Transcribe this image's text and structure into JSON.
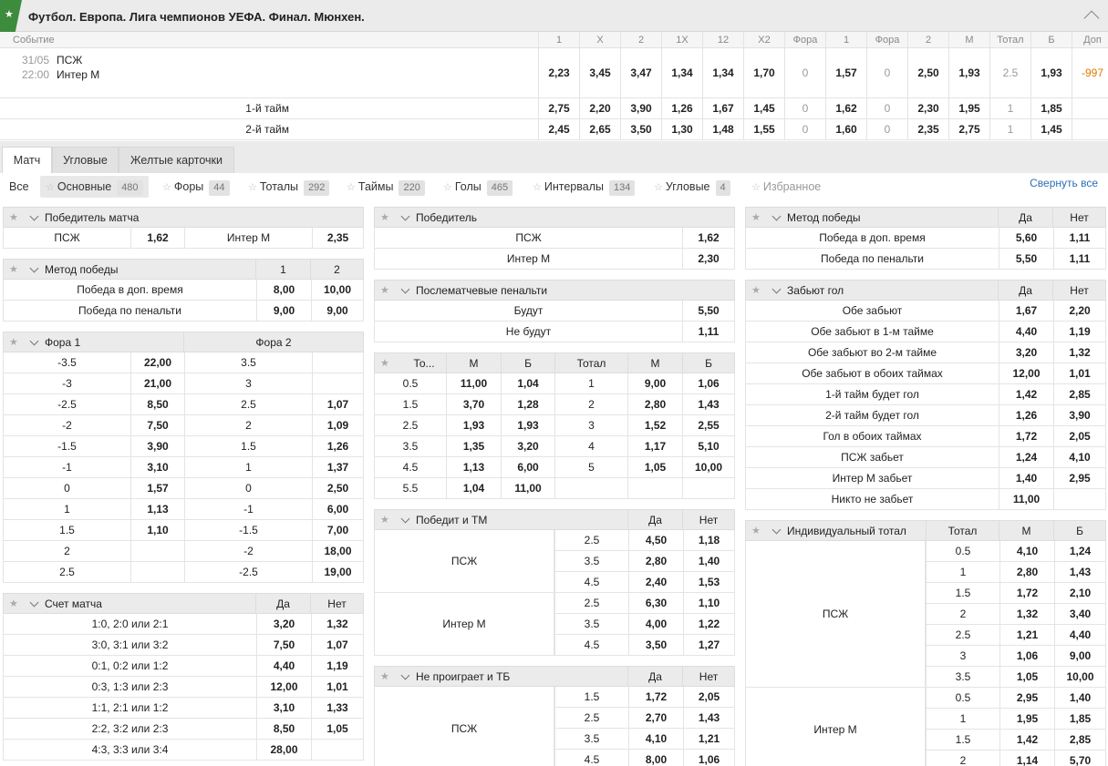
{
  "header": {
    "title": "Футбол. Европа. Лига чемпионов УЕФА. Финал. Мюнхен."
  },
  "market_cols": [
    "Событие",
    "1",
    "X",
    "2",
    "1X",
    "12",
    "X2",
    "Фора",
    "1",
    "Фора",
    "2",
    "М",
    "Тотал",
    "Б",
    "Доп"
  ],
  "event": {
    "date": "31/05",
    "time": "22:00",
    "team1": "ПСЖ",
    "team2": "Интер М",
    "odds": [
      "2,23",
      "3,45",
      "3,47",
      "1,34",
      "1,34",
      "1,70",
      "0",
      "1,57",
      "0",
      "2,50",
      "1,93",
      "2.5",
      "1,93",
      "-997"
    ]
  },
  "halves": [
    {
      "label": "1-й тайм",
      "odds": [
        "2,75",
        "2,20",
        "3,90",
        "1,26",
        "1,67",
        "1,45",
        "0",
        "1,62",
        "0",
        "2,30",
        "1,95",
        "1",
        "1,85"
      ]
    },
    {
      "label": "2-й тайм",
      "odds": [
        "2,45",
        "2,65",
        "3,50",
        "1,30",
        "1,48",
        "1,55",
        "0",
        "1,60",
        "0",
        "2,35",
        "2,75",
        "1",
        "1,45"
      ]
    }
  ],
  "tabs": [
    "Матч",
    "Угловые",
    "Желтые карточки"
  ],
  "filters": {
    "all": "Все",
    "items": [
      {
        "label": "Основные",
        "count": "480"
      },
      {
        "label": "Форы",
        "count": "44"
      },
      {
        "label": "Тоталы",
        "count": "292"
      },
      {
        "label": "Таймы",
        "count": "220"
      },
      {
        "label": "Голы",
        "count": "465"
      },
      {
        "label": "Интервалы",
        "count": "134"
      },
      {
        "label": "Угловые",
        "count": "4"
      },
      {
        "label": "Избранное",
        "count": ""
      }
    ],
    "collapse": "Свернуть все"
  },
  "tables": {
    "winner_match": {
      "title": "Победитель матча",
      "rows": [
        [
          "ПСЖ",
          "1,62",
          "Интер М",
          "2,35"
        ]
      ]
    },
    "win_method_1": {
      "title": "Метод победы",
      "h": [
        "1",
        "2"
      ],
      "rows": [
        [
          "Победа в доп. время",
          "8,00",
          "10,00"
        ],
        [
          "Победа по пенальти",
          "9,00",
          "9,00"
        ]
      ]
    },
    "handicap": {
      "title": "Фора 1",
      "title2": "Фора 2",
      "rows": [
        [
          "-3.5",
          "22,00",
          "3.5",
          ""
        ],
        [
          "-3",
          "21,00",
          "3",
          ""
        ],
        [
          "-2.5",
          "8,50",
          "2.5",
          "1,07"
        ],
        [
          "-2",
          "7,50",
          "2",
          "1,09"
        ],
        [
          "-1.5",
          "3,90",
          "1.5",
          "1,26"
        ],
        [
          "-1",
          "3,10",
          "1",
          "1,37"
        ],
        [
          "0",
          "1,57",
          "0",
          "2,50"
        ],
        [
          "1",
          "1,13",
          "-1",
          "6,00"
        ],
        [
          "1.5",
          "1,10",
          "-1.5",
          "7,00"
        ],
        [
          "2",
          "",
          "-2",
          "18,00"
        ],
        [
          "2.5",
          "",
          "-2.5",
          "19,00"
        ]
      ]
    },
    "score": {
      "title": "Счет матча",
      "h": [
        "Да",
        "Нет"
      ],
      "rows": [
        [
          "1:0, 2:0 или 2:1",
          "3,20",
          "1,32"
        ],
        [
          "3:0, 3:1 или 3:2",
          "7,50",
          "1,07"
        ],
        [
          "0:1, 0:2 или 1:2",
          "4,40",
          "1,19"
        ],
        [
          "0:3, 1:3 или 2:3",
          "12,00",
          "1,01"
        ],
        [
          "1:1, 2:1 или 1:2",
          "3,10",
          "1,33"
        ],
        [
          "2:2, 3:2 или 2:3",
          "8,50",
          "1,05"
        ],
        [
          "4:3, 3:3 или 3:4",
          "28,00",
          ""
        ]
      ]
    },
    "winner": {
      "title": "Победитель",
      "rows": [
        [
          "ПСЖ",
          "1,62"
        ],
        [
          "Интер М",
          "2,30"
        ]
      ]
    },
    "penalties": {
      "title": "Послематчевые пенальти",
      "rows": [
        [
          "Будут",
          "5,50"
        ],
        [
          "Не будут",
          "1,11"
        ]
      ]
    },
    "totals": {
      "h": [
        "То...",
        "М",
        "Б",
        "Тотал",
        "М",
        "Б"
      ],
      "rows": [
        [
          "0.5",
          "11,00",
          "1,04",
          "1",
          "9,00",
          "1,06"
        ],
        [
          "1.5",
          "3,70",
          "1,28",
          "2",
          "2,80",
          "1,43"
        ],
        [
          "2.5",
          "1,93",
          "1,93",
          "3",
          "1,52",
          "2,55"
        ],
        [
          "3.5",
          "1,35",
          "3,20",
          "4",
          "1,17",
          "5,10"
        ],
        [
          "4.5",
          "1,13",
          "6,00",
          "5",
          "1,05",
          "10,00"
        ],
        [
          "5.5",
          "1,04",
          "11,00",
          "",
          "",
          " "
        ]
      ]
    },
    "win_tm": {
      "title": "Победит и ТМ",
      "h": [
        "Да",
        "Нет"
      ],
      "groups": [
        {
          "team": "ПСЖ",
          "rows": [
            [
              "2.5",
              "4,50",
              "1,18"
            ],
            [
              "3.5",
              "2,80",
              "1,40"
            ],
            [
              "4.5",
              "2,40",
              "1,53"
            ]
          ]
        },
        {
          "team": "Интер М",
          "rows": [
            [
              "2.5",
              "6,30",
              "1,10"
            ],
            [
              "3.5",
              "4,00",
              "1,22"
            ],
            [
              "4.5",
              "3,50",
              "1,27"
            ]
          ]
        }
      ]
    },
    "nolose_tb": {
      "title": "Не проиграет и ТБ",
      "h": [
        "Да",
        "Нет"
      ],
      "groups": [
        {
          "team": "ПСЖ",
          "rows": [
            [
              "1.5",
              "1,72",
              "2,05"
            ],
            [
              "2.5",
              "2,70",
              "1,43"
            ],
            [
              "3.5",
              "4,10",
              "1,21"
            ],
            [
              "4.5",
              "8,00",
              "1,06"
            ]
          ]
        }
      ]
    },
    "win_method_2": {
      "title": "Метод победы",
      "h": [
        "Да",
        "Нет"
      ],
      "rows": [
        [
          "Победа в доп. время",
          "5,60",
          "1,11"
        ],
        [
          "Победа по пенальти",
          "5,50",
          "1,11"
        ]
      ]
    },
    "goals": {
      "title": "Забьют гол",
      "h": [
        "Да",
        "Нет"
      ],
      "rows": [
        [
          "Обе забьют",
          "1,67",
          "2,20"
        ],
        [
          "Обе забьют в 1-м тайме",
          "4,40",
          "1,19"
        ],
        [
          "Обе забьют во 2-м тайме",
          "3,20",
          "1,32"
        ],
        [
          "Обе забьют в обоих таймах",
          "12,00",
          "1,01"
        ],
        [
          "1-й тайм будет гол",
          "1,42",
          "2,85"
        ],
        [
          "2-й тайм будет гол",
          "1,26",
          "3,90"
        ],
        [
          "Гол в обоих таймах",
          "1,72",
          "2,05"
        ],
        [
          "ПСЖ забьет",
          "1,24",
          "4,10"
        ],
        [
          "Интер М забьет",
          "1,40",
          "2,95"
        ],
        [
          "Никто не забьет",
          "11,00",
          ""
        ]
      ]
    },
    "ind_total": {
      "title": "Индивидуальный тотал",
      "h": [
        "Тотал",
        "М",
        "Б"
      ],
      "groups": [
        {
          "team": "ПСЖ",
          "rows": [
            [
              "0.5",
              "4,10",
              "1,24"
            ],
            [
              "1",
              "2,80",
              "1,43"
            ],
            [
              "1.5",
              "1,72",
              "2,10"
            ],
            [
              "2",
              "1,32",
              "3,40"
            ],
            [
              "2.5",
              "1,21",
              "4,40"
            ],
            [
              "3",
              "1,06",
              "9,00"
            ],
            [
              "3.5",
              "1,05",
              "10,00"
            ]
          ]
        },
        {
          "team": "Интер М",
          "rows": [
            [
              "0.5",
              "2,95",
              "1,40"
            ],
            [
              "1",
              "1,95",
              "1,85"
            ],
            [
              "1.5",
              "1,42",
              "2,85"
            ],
            [
              "2",
              "1,14",
              "5,70"
            ]
          ]
        }
      ]
    }
  }
}
